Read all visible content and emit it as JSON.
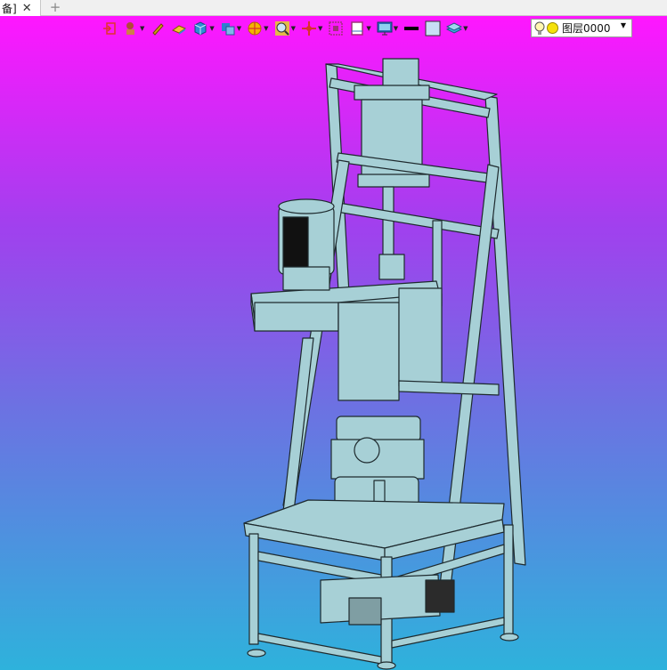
{
  "tab": {
    "title": "备]",
    "close_glyph": "✕",
    "new_glyph": "+"
  },
  "toolbar": {
    "items": [
      {
        "name": "exit-sketch-icon",
        "color": "#e0342c"
      },
      {
        "name": "user-coordinate-icon",
        "color": "#b04a3a"
      },
      {
        "name": "pen-icon",
        "color": "#d4a017"
      },
      {
        "name": "eraser-icon",
        "color": "#f2c230"
      },
      {
        "name": "solid-box-icon",
        "color": "#2e8fd6"
      },
      {
        "name": "view-orientation-icon",
        "color": "#2e7fd0"
      },
      {
        "name": "render-mode-icon",
        "color": "#f4b400"
      },
      {
        "name": "zoom-icon",
        "color": "#e3b84a"
      },
      {
        "name": "pan-icon",
        "color": "#d8322c"
      },
      {
        "name": "section-view-icon",
        "color": "#a0307a"
      },
      {
        "name": "window-icon",
        "color": "#3a6fc0"
      },
      {
        "name": "display-settings-icon",
        "color": "#2d6bb8"
      },
      {
        "name": "line-color-icon",
        "color": "#000000"
      },
      {
        "name": "fill-color-icon",
        "color": "#c8dff5"
      },
      {
        "name": "layer-style-icon",
        "color": "#3aa8d8"
      }
    ]
  },
  "layer": {
    "name": "图层0000",
    "caret": "▼"
  },
  "viewport": {
    "gradient_top": "#ff16ff",
    "gradient_bottom": "#2eb2dc",
    "model_color": "#a7d0d6",
    "edge_color": "#1e2a2e"
  }
}
